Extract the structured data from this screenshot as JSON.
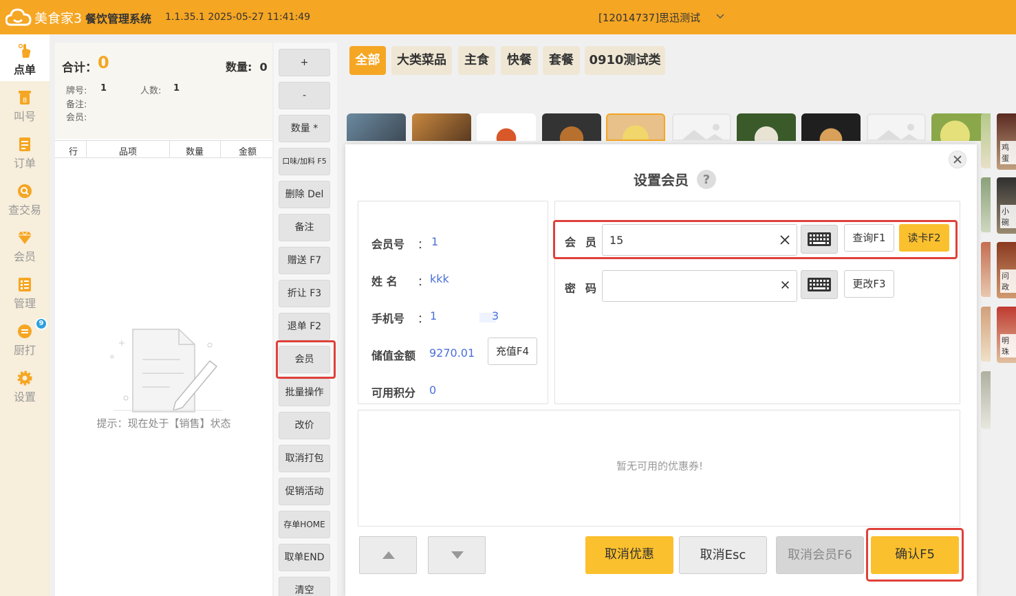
{
  "app": {
    "logo_text": "美食家3",
    "system_title": "餐饮管理系统",
    "version": "1.1.35.1 2025-05-27 11:41:49",
    "store": "[12014737]思迅测试"
  },
  "nav": {
    "items": [
      {
        "label": "点单",
        "icon": "hand-pointer-icon"
      },
      {
        "label": "叫号",
        "icon": "number-ticket-icon"
      },
      {
        "label": "订单",
        "icon": "order-list-icon"
      },
      {
        "label": "查交易",
        "icon": "search-transaction-icon"
      },
      {
        "label": "会员",
        "icon": "diamond-icon"
      },
      {
        "label": "管理",
        "icon": "management-icon"
      },
      {
        "label": "厨打",
        "icon": "kitchen-print-icon"
      },
      {
        "label": "设置",
        "icon": "gear-icon"
      }
    ],
    "kitchen_badge": "9"
  },
  "order": {
    "total_label": "合计：",
    "total_value": "0",
    "qty_label": "数量:",
    "qty_value": "0",
    "card_label": "牌号:",
    "card_value": "1",
    "people_label": "人数:",
    "people_value": "1",
    "note_label": "备注:",
    "member_label": "会员:",
    "columns": [
      "行",
      "品项",
      "数量",
      "金额"
    ],
    "empty_hint": "提示：现在处于【销售】状态"
  },
  "actions": [
    "+",
    "-",
    "数量 *",
    "口味/加料 F5",
    "删除 Del",
    "备注",
    "赠送 F7",
    "折让 F3",
    "退单 F2",
    "会员",
    "批量操作",
    "改价",
    "取消打包",
    "促销活动",
    "存单HOME",
    "取单END",
    "清空"
  ],
  "categories": [
    "全部",
    "大类菜品",
    "主食",
    "快餐",
    "套餐",
    "0910测试类"
  ],
  "dish_labels": [
    "鸡蛋",
    "小碗",
    "问政",
    "明珠"
  ],
  "modal": {
    "title": "设置会员",
    "member_info": {
      "member_no_label": "会员号",
      "member_no": "1",
      "name_label": "姓  名",
      "name": "kkk",
      "phone_label": "手机号",
      "phone_start": "1",
      "phone_end": "3",
      "balance_label": "储值金额",
      "balance": "9270.01",
      "recharge_button": "充值F4",
      "points_label": "可用积分",
      "points": "0",
      "colon": "："
    },
    "form": {
      "member_label": "会员",
      "member_value": "15",
      "query_button": "查询F1",
      "read_card_button": "读卡F2",
      "password_label": "密码",
      "password_value": "",
      "change_button": "更改F3"
    },
    "coupon_empty": "暂无可用的优惠券!",
    "buttons": {
      "cancel_discount": "取消优惠",
      "cancel_esc": "取消Esc",
      "cancel_member": "取消会员F6",
      "confirm": "确认F5"
    }
  },
  "colors": {
    "brand": "#F5A623",
    "link": "#4A6FD8",
    "highlight": "#E0403A",
    "confirm": "#FBC02D"
  }
}
